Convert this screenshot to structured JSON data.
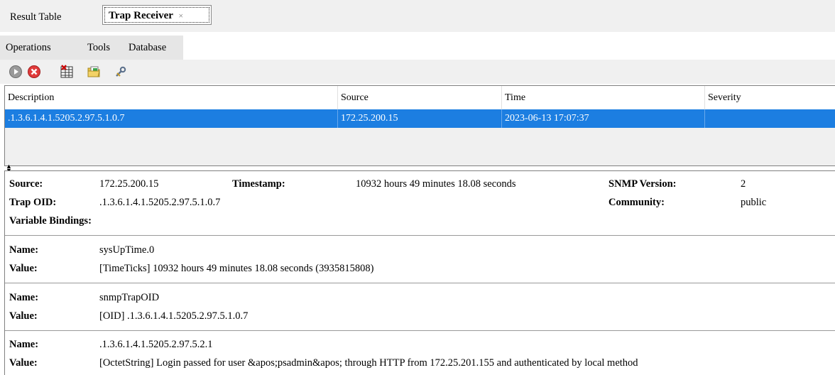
{
  "tabs": {
    "result_table": "Result Table",
    "trap_receiver": "Trap Receiver",
    "close_glyph": "×"
  },
  "menu": [
    "Operations",
    "Tools",
    "Database"
  ],
  "toolbar": {
    "icons": [
      "start-icon",
      "stop-icon",
      "clear-table-icon",
      "open-folder-icon",
      "settings-wrench-icon"
    ]
  },
  "table": {
    "columns": [
      "Description",
      "Source",
      "Time",
      "Severity"
    ],
    "rows": [
      {
        "description": ".1.3.6.1.4.1.5205.2.97.5.1.0.7",
        "source": "172.25.200.15",
        "time": "2023-06-13 17:07:37",
        "severity": ""
      }
    ]
  },
  "detail": {
    "source_label": "Source:",
    "source_value": "172.25.200.15",
    "timestamp_label": "Timestamp:",
    "timestamp_value": "10932 hours 49 minutes 18.08 seconds",
    "snmp_version_label": "SNMP Version:",
    "snmp_version_value": "2",
    "trap_oid_label": "Trap OID:",
    "trap_oid_value": ".1.3.6.1.4.1.5205.2.97.5.1.0.7",
    "community_label": "Community:",
    "community_value": "public",
    "variable_bindings_label": "Variable Bindings:",
    "name_label": "Name:",
    "value_label": "Value:",
    "bindings": [
      {
        "name": "sysUpTime.0",
        "value": "[TimeTicks] 10932 hours 49 minutes 18.08 seconds (3935815808)"
      },
      {
        "name": "snmpTrapOID",
        "value": "[OID] .1.3.6.1.4.1.5205.2.97.5.1.0.7"
      },
      {
        "name": ".1.3.6.1.4.1.5205.2.97.5.2.1",
        "value": "[OctetString] Login passed for user &apos;psadmin&apos; through HTTP from 172.25.201.155 and authenticated by local method"
      }
    ]
  },
  "colors": {
    "selection": "#1c7ee1",
    "panel_bg": "#f0f0f0"
  }
}
